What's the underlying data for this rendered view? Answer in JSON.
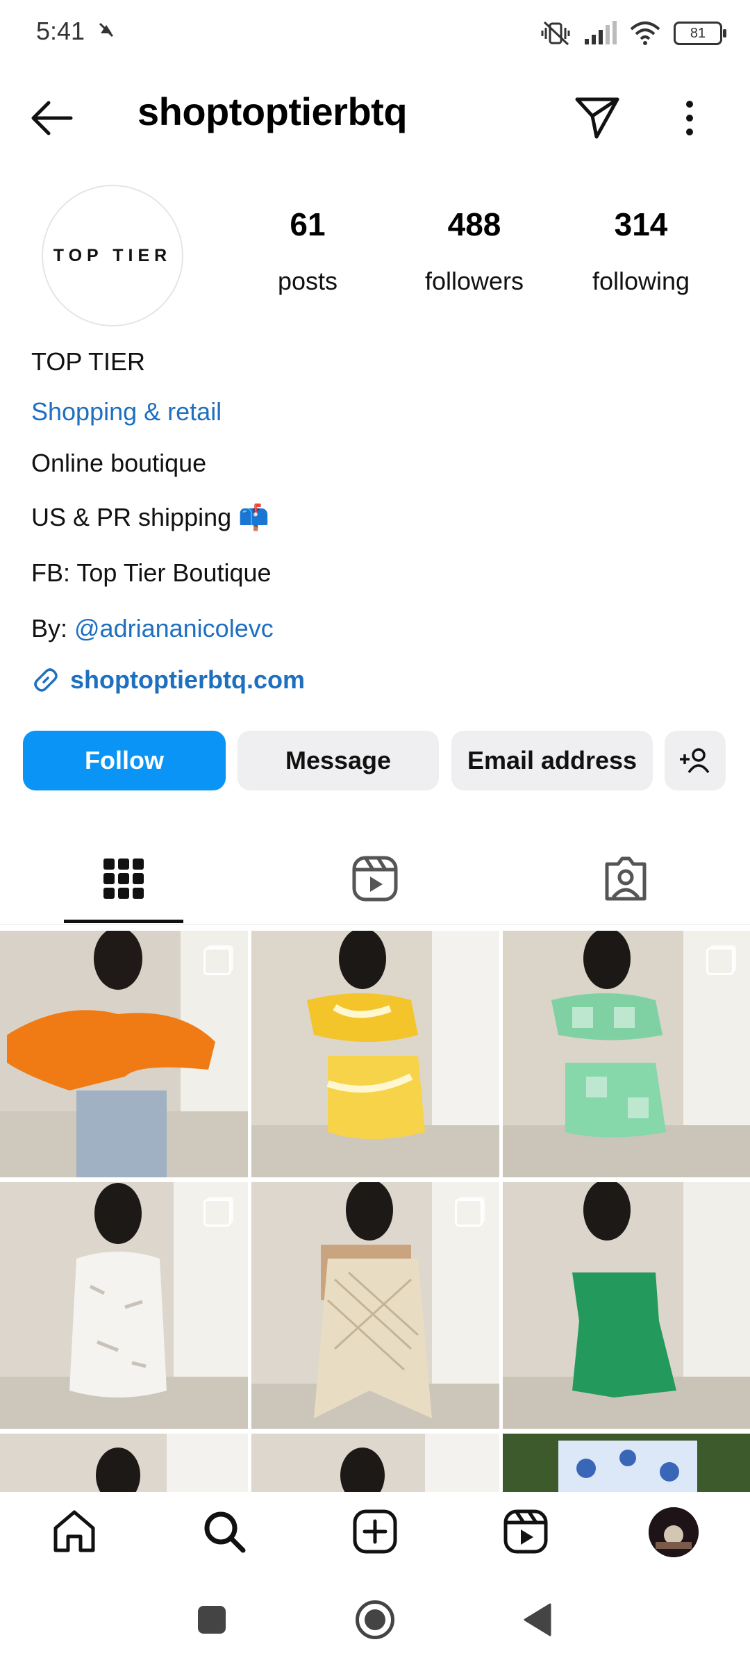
{
  "status_bar": {
    "time": "5:41",
    "battery": "81"
  },
  "header": {
    "username": "shoptoptierbtq"
  },
  "profile": {
    "avatar_text": "TOP TIER",
    "stats": [
      {
        "value": "61",
        "label": "posts"
      },
      {
        "value": "488",
        "label": "followers"
      },
      {
        "value": "314",
        "label": "following"
      }
    ],
    "bio": {
      "name": "TOP TIER",
      "category": "Shopping & retail",
      "line1": "Online boutique",
      "line2": "US & PR shipping 📫",
      "line3": "FB: Top Tier Boutique",
      "by_label": "By: ",
      "by_handle": "@adriananicolevc",
      "link": "shoptoptierbtq.com"
    }
  },
  "actions": {
    "follow": "Follow",
    "message": "Message",
    "email": "Email address"
  },
  "tabs": [
    "grid-tab",
    "reels-tab",
    "tagged-tab"
  ],
  "colors": {
    "accent": "#0a95f6",
    "link": "#1e6fc0"
  }
}
